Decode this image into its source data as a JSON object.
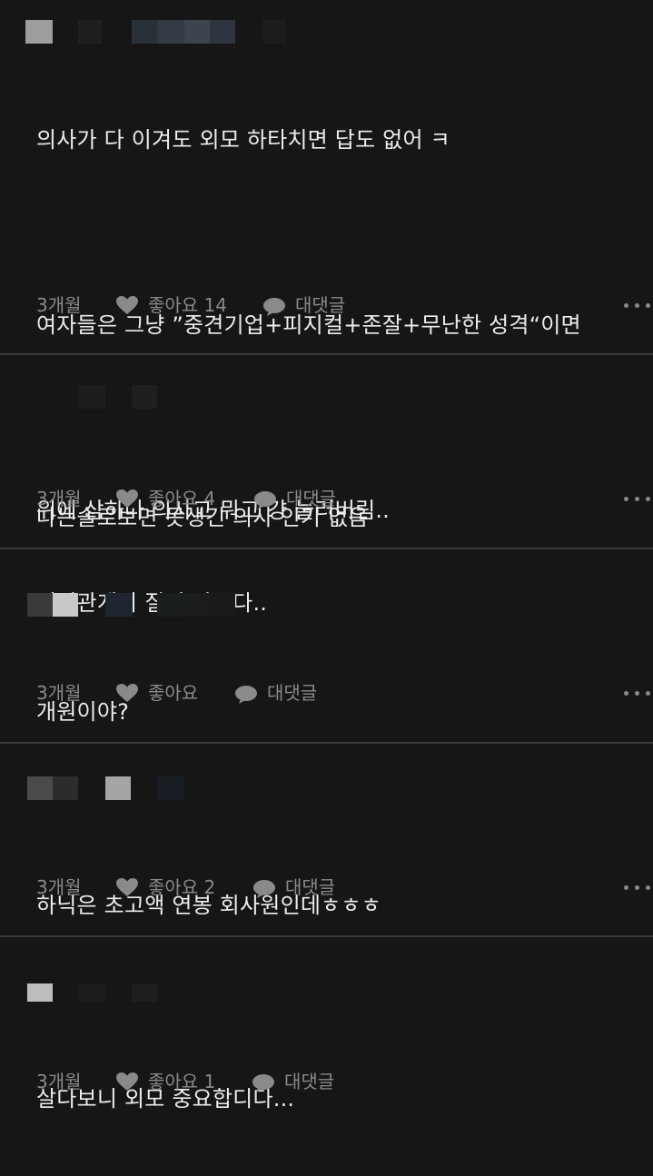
{
  "comments": [
    {
      "lines": [
        "의사가 다 이겨도 외모 하타치면 답도 없어 ㅋ",
        "",
        "여자들은 그냥 ”중견기업+피지컬+존잘+무난한 성격“이면",
        "",
        "위에 삼하나 의사고 뭐고 걍 눌러버림..",
        "이성관계의 질이 다르다.."
      ],
      "time": "3개월",
      "like_label": "좋아요 14",
      "reply_label": "대댓글"
    },
    {
      "lines": [
        "나는솔로보면 못생긴 의사 인기 없음"
      ],
      "time": "3개월",
      "like_label": "좋아요 4",
      "reply_label": "대댓글"
    },
    {
      "lines": [
        "개원이야?"
      ],
      "time": "3개월",
      "like_label": "좋아요",
      "reply_label": "대댓글"
    },
    {
      "lines": [
        "하닉은 초고액 연봉 회사원인데ㅎㅎㅎ"
      ],
      "time": "3개월",
      "like_label": "좋아요 2",
      "reply_label": "대댓글"
    },
    {
      "lines": [
        "살다보니 외모 중요합디다..."
      ],
      "time": "3개월",
      "like_label": "좋아요 1",
      "reply_label": "대댓글"
    }
  ],
  "icons": {
    "like": "heart-icon",
    "reply": "speech-bubble-icon",
    "more": "more-dots-icon"
  },
  "colors": {
    "background": "#161616",
    "text": "#ececec",
    "meta": "#8a8a8a",
    "divider": "#3a3a3a"
  }
}
